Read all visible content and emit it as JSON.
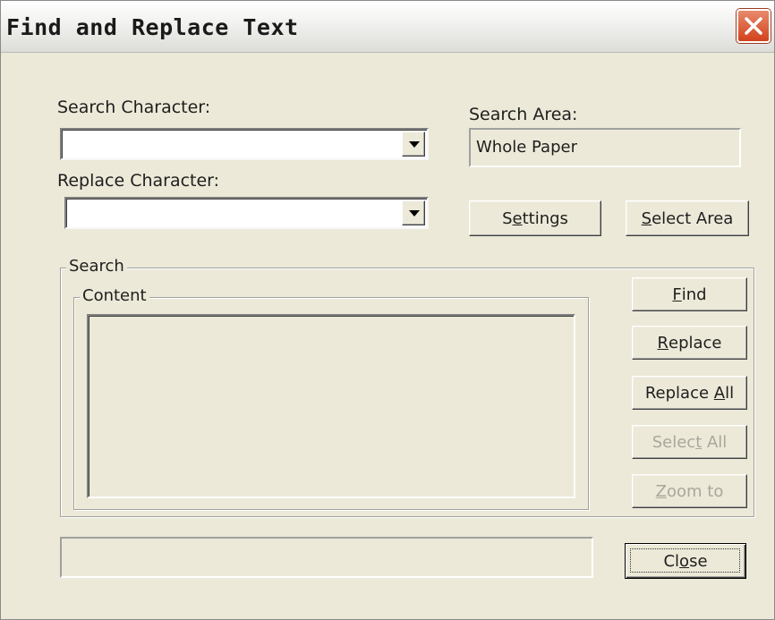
{
  "window": {
    "title": "Find and Replace Text",
    "close_icon": "close-x-icon",
    "close_color": "#d1421c"
  },
  "search_character": {
    "label": "Search Character:",
    "value": ""
  },
  "replace_character": {
    "label": "Replace Character:",
    "value": ""
  },
  "search_area": {
    "label": "Search Area:",
    "value": "Whole Paper"
  },
  "buttons": {
    "settings": {
      "pre": "S",
      "u": "e",
      "post": "ttings"
    },
    "select_area": {
      "pre": "",
      "u": "S",
      "post": "elect Area"
    },
    "find": {
      "pre": "",
      "u": "F",
      "post": "ind"
    },
    "replace": {
      "pre": "",
      "u": "R",
      "post": "eplace"
    },
    "replace_all": {
      "pre": "Replace ",
      "u": "A",
      "post": "ll"
    },
    "select_all": {
      "pre": "Selec",
      "u": "t",
      "post": " All"
    },
    "zoom_to": {
      "pre": "",
      "u": "Z",
      "post": "oom to"
    },
    "close": {
      "pre": "Cl",
      "u": "o",
      "post": "se"
    }
  },
  "groups": {
    "search_title": "Search",
    "content_title": "Content"
  },
  "status": {
    "text": ""
  }
}
